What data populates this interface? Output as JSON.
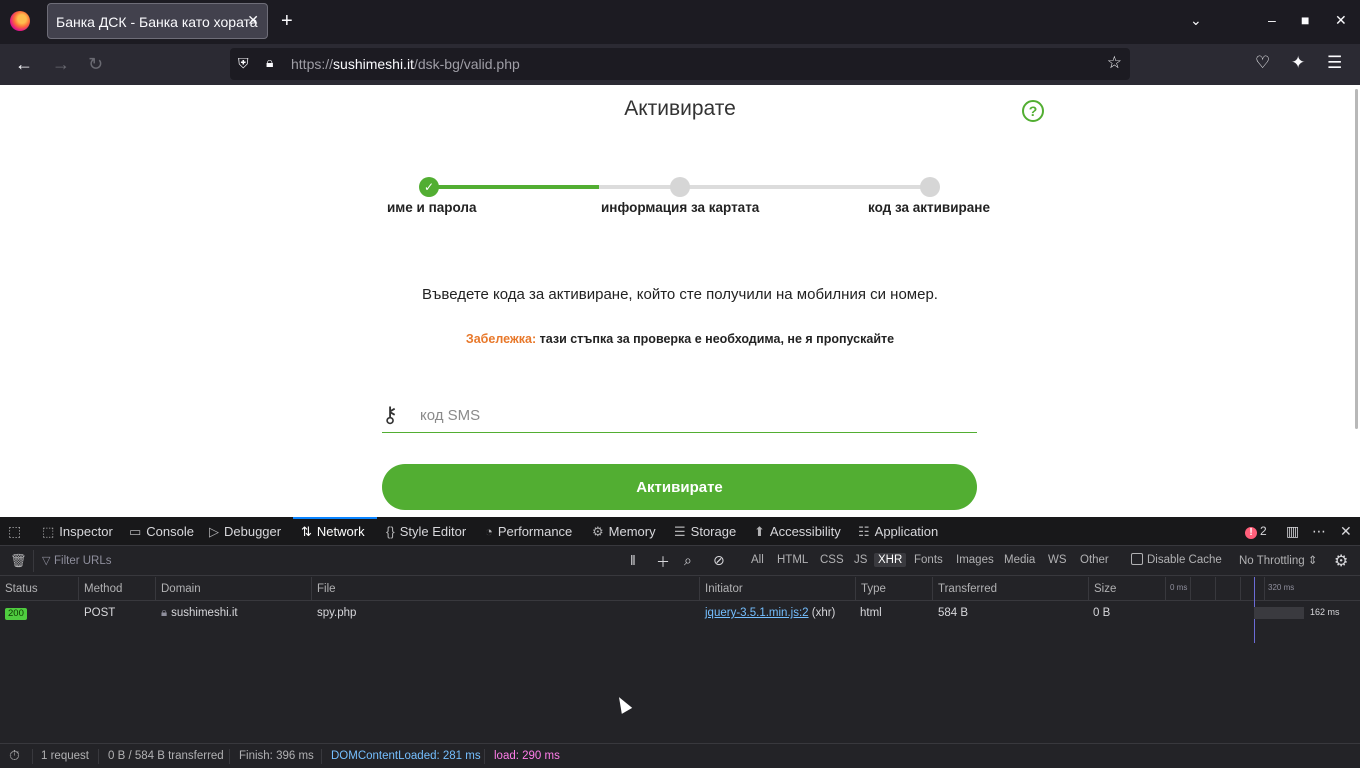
{
  "browser": {
    "tab_title": "Банка ДСК - Банка като хората",
    "tab_close": "✕",
    "new_tab": "+",
    "url_scheme": "https://",
    "url_domain": "sushimeshi.it",
    "url_path": "/dsk-bg/valid.php"
  },
  "page": {
    "title": "Активирате",
    "help": "?",
    "steps": [
      {
        "label": "име и парола",
        "state": "done"
      },
      {
        "label": "информация за картата",
        "state": "current"
      },
      {
        "label": "код за активиране",
        "state": "pending"
      }
    ],
    "progress_fraction": 0.34,
    "instruction": "Въведете кода за активиране, който сте получили на мобилния си номер.",
    "note_label": "Забележка:",
    "note_text": " тази стъпка за проверка е необходима, не я пропускайте",
    "sms_placeholder": "код SMS",
    "submit_label": "Активирате",
    "accent_color": "#52ae32",
    "note_color": "#e8782a"
  },
  "devtools": {
    "tabs": [
      {
        "label": "Inspector",
        "icon": "inspector-icon"
      },
      {
        "label": "Console",
        "icon": "console-icon"
      },
      {
        "label": "Debugger",
        "icon": "debugger-icon"
      },
      {
        "label": "Network",
        "icon": "network-icon",
        "active": true
      },
      {
        "label": "Style Editor",
        "icon": "style-editor-icon"
      },
      {
        "label": "Performance",
        "icon": "performance-icon"
      },
      {
        "label": "Memory",
        "icon": "memory-icon"
      },
      {
        "label": "Storage",
        "icon": "storage-icon"
      },
      {
        "label": "Accessibility",
        "icon": "accessibility-icon"
      },
      {
        "label": "Application",
        "icon": "application-icon"
      }
    ],
    "error_count": "2",
    "filter_placeholder": "Filter URLs",
    "filter_types": [
      "All",
      "HTML",
      "CSS",
      "JS",
      "XHR",
      "Fonts",
      "Images",
      "Media",
      "WS",
      "Other"
    ],
    "active_filter": "XHR",
    "disable_cache": "Disable Cache",
    "throttling": "No Throttling ⇕",
    "columns": [
      "Status",
      "Method",
      "Domain",
      "File",
      "Initiator",
      "Type",
      "Transferred",
      "Size"
    ],
    "waterfall_ticks": [
      "0 ms",
      "320 ms"
    ],
    "request": {
      "status": "200",
      "method": "POST",
      "domain": "sushimeshi.it",
      "file": "spy.php",
      "initiator_link": "jquery-3.5.1.min.js:2",
      "initiator_suffix": " (xhr)",
      "type": "html",
      "transferred": "584 B",
      "size": "0 B",
      "timing": "162 ms"
    },
    "summary": {
      "requests": "1 request",
      "transferred": "0 B / 584 B transferred",
      "finish": "Finish: 396 ms",
      "dom_loaded": "DOMContentLoaded: 281 ms",
      "load": "load: 290 ms"
    }
  }
}
